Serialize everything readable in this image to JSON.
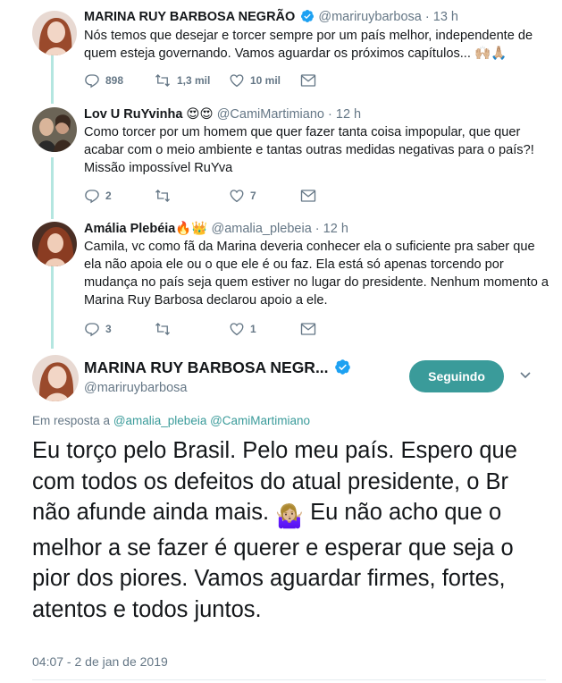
{
  "tweets": [
    {
      "name": "MARINA RUY BARBOSA NEGRÃO",
      "handle": "@mariruybarbosa",
      "dot": "·",
      "time": "13 h",
      "verified": true,
      "text": "Nós temos que desejar e torcer sempre por um país melhor, independente de quem esteja governando. Vamos aguardar os próximos capítulos...",
      "text_emoji": "🙌🏼🙏🏼",
      "replies": "898",
      "retweets": "1,3 mil",
      "likes": "10 mil"
    },
    {
      "name": "Lov U RuYvinha",
      "name_emoji": "😍😍",
      "handle": "@CamiMartimiano",
      "dot": "·",
      "time": "12 h",
      "text": "Como torcer por um homem que quer fazer tanta coisa impopular, que quer acabar com o meio ambiente e tantas outras medidas negativas para o país?! Missão impossível RuYva",
      "replies": "2",
      "retweets": "",
      "likes": "7"
    },
    {
      "name": "Amália Plebéia",
      "name_emoji": "🔥👑",
      "handle": "@amalia_plebeia",
      "dot": "·",
      "time": "12 h",
      "text": "Camila, vc como fã da Marina deveria conhecer ela o suficiente pra saber que ela não apoia ele ou o que ele é ou faz. Ela está só apenas torcendo por mudança no país seja quem estiver no lugar do presidente. Nenhum momento a Marina Ruy Barbosa declarou apoio a ele.",
      "replies": "3",
      "retweets": "",
      "likes": "1"
    }
  ],
  "main": {
    "name": "MARINA RUY BARBOSA NEGR...",
    "handle": "@mariruybarbosa",
    "follow_label": "Seguindo",
    "reply_prefix": "Em resposta a",
    "reply_mentions": "@amalia_plebeia @CamiMartimiano",
    "text_part1": "Eu torço pelo Brasil. Pelo meu país. Espero que com todos os defeitos do atual presidente, o Br não afunde ainda mais.",
    "text_emoji": "🤷🏼‍♀️",
    "text_part2": "Eu não acho que o melhor a se fazer é querer e esperar que seja o pior dos piores. Vamos aguardar firmes, fortes, atentos e todos juntos.",
    "date": "04:07 - 2 de jan de 2019"
  },
  "colors": {
    "accent": "#3a9b9a",
    "verified": "#1da1f2",
    "thread_line": "#b4e6e0",
    "muted": "#657786"
  },
  "icons": [
    "reply-icon",
    "retweet-icon",
    "like-icon",
    "dm-icon",
    "verified-icon",
    "chevron-down-icon"
  ]
}
